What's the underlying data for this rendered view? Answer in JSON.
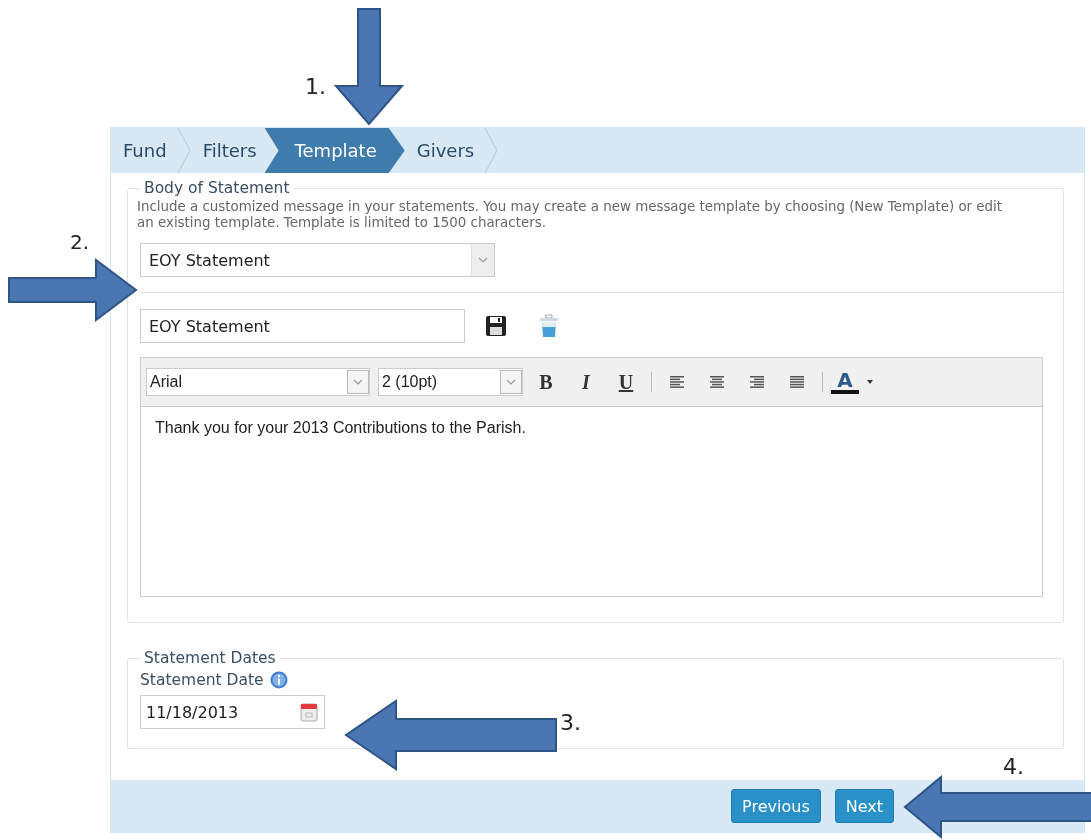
{
  "tabs": [
    {
      "label": "Fund",
      "selected": false
    },
    {
      "label": "Filters",
      "selected": false
    },
    {
      "label": "Template",
      "selected": true
    },
    {
      "label": "Givers",
      "selected": false
    }
  ],
  "body_section": {
    "legend": "Body of Statement",
    "description": "Include a customized message in your statements. You may create a new message template by choosing (New Template) or edit an existing template. Template is limited to 1500 characters.",
    "template_select": {
      "value": "EOY Statement"
    },
    "template_name": {
      "value": "EOY Statement"
    },
    "editor": {
      "font": "Arial",
      "size": "2 (10pt)",
      "toolbar": [
        {
          "kind": "bold",
          "label": "B"
        },
        {
          "kind": "italic",
          "label": "I"
        },
        {
          "kind": "underline",
          "label": "U"
        },
        {
          "kind": "separator"
        },
        {
          "kind": "align-left"
        },
        {
          "kind": "align-center"
        },
        {
          "kind": "align-right"
        },
        {
          "kind": "justify"
        },
        {
          "kind": "separator"
        },
        {
          "kind": "text-color",
          "label": "A"
        }
      ],
      "content": "Thank you for your 2013 Contributions to the Parish."
    }
  },
  "dates_section": {
    "legend": "Statement Dates",
    "label": "Statement Date",
    "date": "11/18/2013"
  },
  "buttons": [
    "Previous",
    "Next"
  ],
  "annotations": [
    "1.",
    "2.",
    "3.",
    "4."
  ]
}
